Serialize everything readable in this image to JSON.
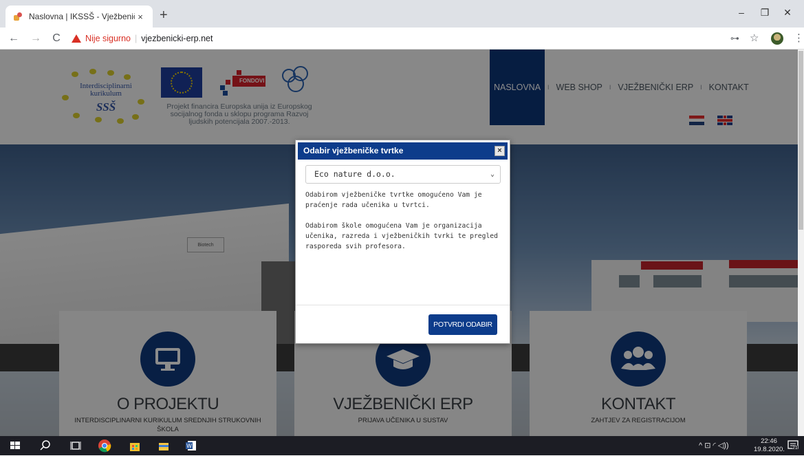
{
  "browser": {
    "tab_title": "Naslovna | IKSSŠ - Vježbenički E",
    "tab_close": "×",
    "new_tab": "+",
    "security_label": "Nije sigurno",
    "separator": "|",
    "url": "vjezbenicki-erp.net",
    "window_controls": {
      "minimize": "–",
      "maximize": "❐",
      "close": "✕"
    },
    "nav": {
      "back": "←",
      "forward": "→",
      "reload": "C"
    },
    "right_icons": {
      "key": "⊶",
      "star": "☆",
      "menu": "⋮"
    }
  },
  "header": {
    "logo_line1": "Interdisciplinarni",
    "logo_line2": "kurikulum",
    "logo_line3": "SSŠ",
    "fondovi_label": "FONDOVI",
    "project_text_1": "Projekt financira Europska unija iz Europskog",
    "project_text_2": "socijalnog fonda u sklopu programa Razvoj",
    "project_text_3": "ljudskih potencijala 2007.-2013.",
    "nav": [
      {
        "label": "NASLOVNA"
      },
      {
        "label": "WEB SHOP"
      },
      {
        "label": "VJEŽBENIČKI ERP"
      },
      {
        "label": "KONTAKT"
      }
    ],
    "nav_separator": "I"
  },
  "hero": {
    "sign_label": "Biotech"
  },
  "cards": [
    {
      "title": "O PROJEKTU",
      "sub": "INTERDISCIPLINARNI KURIKULUM SREDNJIH STRUKOVNIH ŠKOLA"
    },
    {
      "title": "VJEŽBENIČKI ERP",
      "sub": "PRIJAVA UČENIKA U SUSTAV"
    },
    {
      "title": "KONTAKT",
      "sub": "ZAHTJEV ZA REGISTRACIJOM"
    }
  ],
  "modal": {
    "title": "Odabir vježbeničke tvrtke",
    "close": "×",
    "selected_company": "Eco nature d.o.o.",
    "para1": "Odabirom vježbeničke tvrtke omogućeno Vam je praćenje rada učenika u tvrtci.",
    "para2": "Odabirom škole omogućena Vam je organizacija učenika, razreda i vježbeničkih tvrki te pregled rasporeda svih profesora.",
    "confirm_button": "POTVRDI ODABIR"
  },
  "taskbar": {
    "time": "22:46",
    "date": "19.8.2020.",
    "tray_icons": "^ ⊡ ◜ ◁))",
    "notification_count": "21"
  },
  "colors": {
    "primary_blue": "#0d3c8b",
    "warning_red": "#d93025"
  }
}
